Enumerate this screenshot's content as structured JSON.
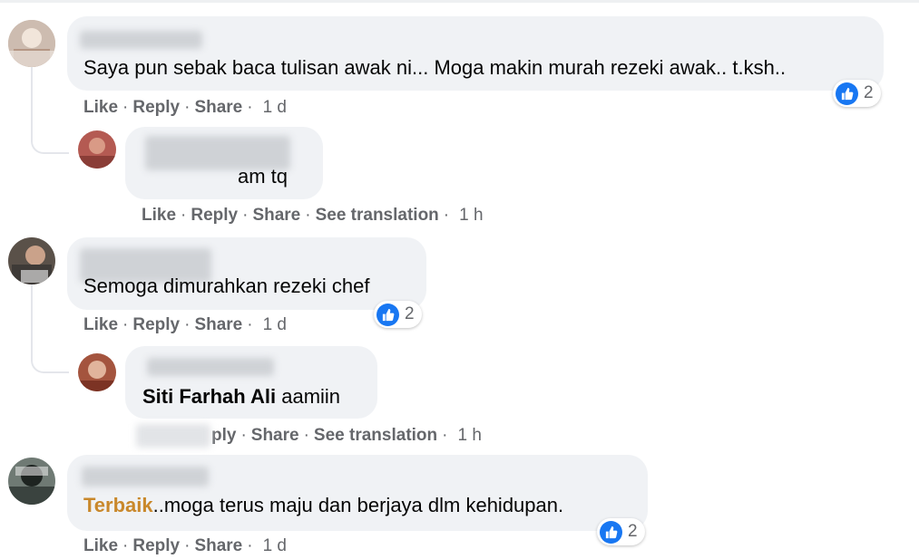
{
  "colors": {
    "like_blue": "#1877f2",
    "meta_gray": "#65676b",
    "bubble_bg": "#f0f2f5",
    "tag_gold": "#c9882b"
  },
  "actions": {
    "like": "Like",
    "reply": "Reply",
    "share": "Share",
    "see_translation": "See translation",
    "reply_partial": "ply"
  },
  "comments": [
    {
      "text": "Saya pun sebak baca tulisan awak ni... Moga makin murah rezeki awak.. t.ksh..",
      "time": "1 d",
      "reactions": "2"
    },
    {
      "text_partial": "am tq",
      "time": "1 h"
    },
    {
      "text": "Semoga dimurahkan rezeki chef",
      "time": "1 d",
      "reactions": "2"
    },
    {
      "tag_name": "Siti Farhah Ali",
      "text": "aamiin",
      "time": "1 h"
    },
    {
      "tag": "Terbaik",
      "text": "..moga terus maju dan berjaya dlm kehidupan.",
      "time": "1 d",
      "reactions": "2"
    }
  ],
  "icons": {
    "reaction": "like-icon",
    "avatar": "avatar"
  }
}
